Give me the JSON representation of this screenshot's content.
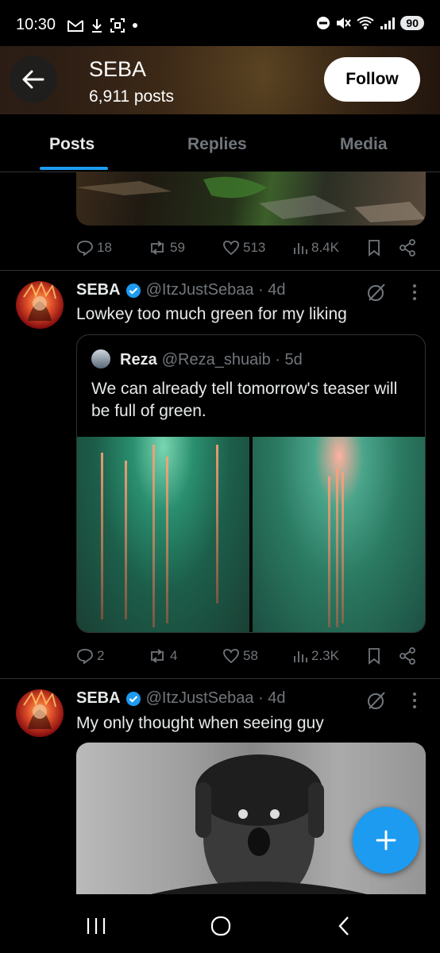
{
  "status_bar": {
    "time": "10:30",
    "battery": "90"
  },
  "header": {
    "title": "SEBA",
    "subtitle": "6,911 posts",
    "follow_label": "Follow"
  },
  "tabs": [
    {
      "label": "Posts"
    },
    {
      "label": "Replies"
    },
    {
      "label": "Media"
    }
  ],
  "posts": [
    {
      "stats": {
        "replies": "18",
        "reposts": "59",
        "likes": "513",
        "views": "8.4K"
      }
    },
    {
      "author": "SEBA",
      "handle": "@ItzJustSebaa · 4d",
      "text": "Lowkey too much green for my liking",
      "quote": {
        "author": "Reza",
        "handle": "@Reza_shuaib · 5d",
        "text": "We can already tell tomorrow's teaser will be full of green."
      },
      "stats": {
        "replies": "2",
        "reposts": "4",
        "likes": "58",
        "views": "2.3K"
      }
    },
    {
      "author": "SEBA",
      "handle": "@ItzJustSebaa · 4d",
      "text": "My only thought when seeing guy"
    }
  ],
  "colors": {
    "accent": "#1d9bf0",
    "background": "#000000",
    "muted": "#71767b"
  }
}
